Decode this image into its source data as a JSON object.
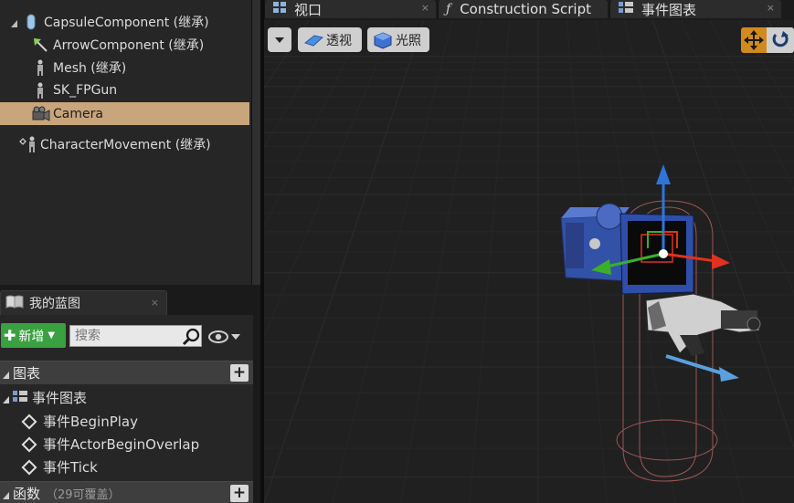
{
  "components": {
    "items": [
      {
        "label": "CapsuleComponent (继承)",
        "icon": "capsule-icon"
      },
      {
        "label": "ArrowComponent (继承)",
        "icon": "arrow-component-icon"
      },
      {
        "label": "Mesh (继承)",
        "icon": "skeletal-mesh-icon"
      },
      {
        "label": "SK_FPGun",
        "icon": "skeletal-mesh-icon"
      },
      {
        "label": "Camera",
        "icon": "camera-icon",
        "selected": true
      },
      {
        "label": "CharacterMovement (继承)",
        "icon": "movement-icon"
      }
    ]
  },
  "my_blueprint": {
    "tab_label": "我的蓝图",
    "close": "×",
    "add_label": "新增",
    "search_placeholder": "搜索",
    "graphs_section": "图表",
    "event_graph": "事件图表",
    "events": [
      "事件BeginPlay",
      "事件ActorBeginOverlap",
      "事件Tick"
    ],
    "functions_section": "函数",
    "functions_sub": "（29可覆盖）",
    "section_add": "+"
  },
  "editor_tabs": [
    {
      "label": "视口",
      "icon": "viewport-icon",
      "close": "×"
    },
    {
      "label": "Construction Script",
      "icon": "function-icon",
      "close": ""
    },
    {
      "label": "事件图表",
      "icon": "graph-icon",
      "close": "×"
    }
  ],
  "viewport": {
    "perspective_label": "透视",
    "lit_label": "光照"
  },
  "colors": {
    "selection": "#c9a57c",
    "add_button": "#3aa140",
    "transform_active": "#d18a1e",
    "gizmo_x": "#e0321e",
    "gizmo_y": "#3ab02a",
    "gizmo_z": "#2f74d8"
  }
}
